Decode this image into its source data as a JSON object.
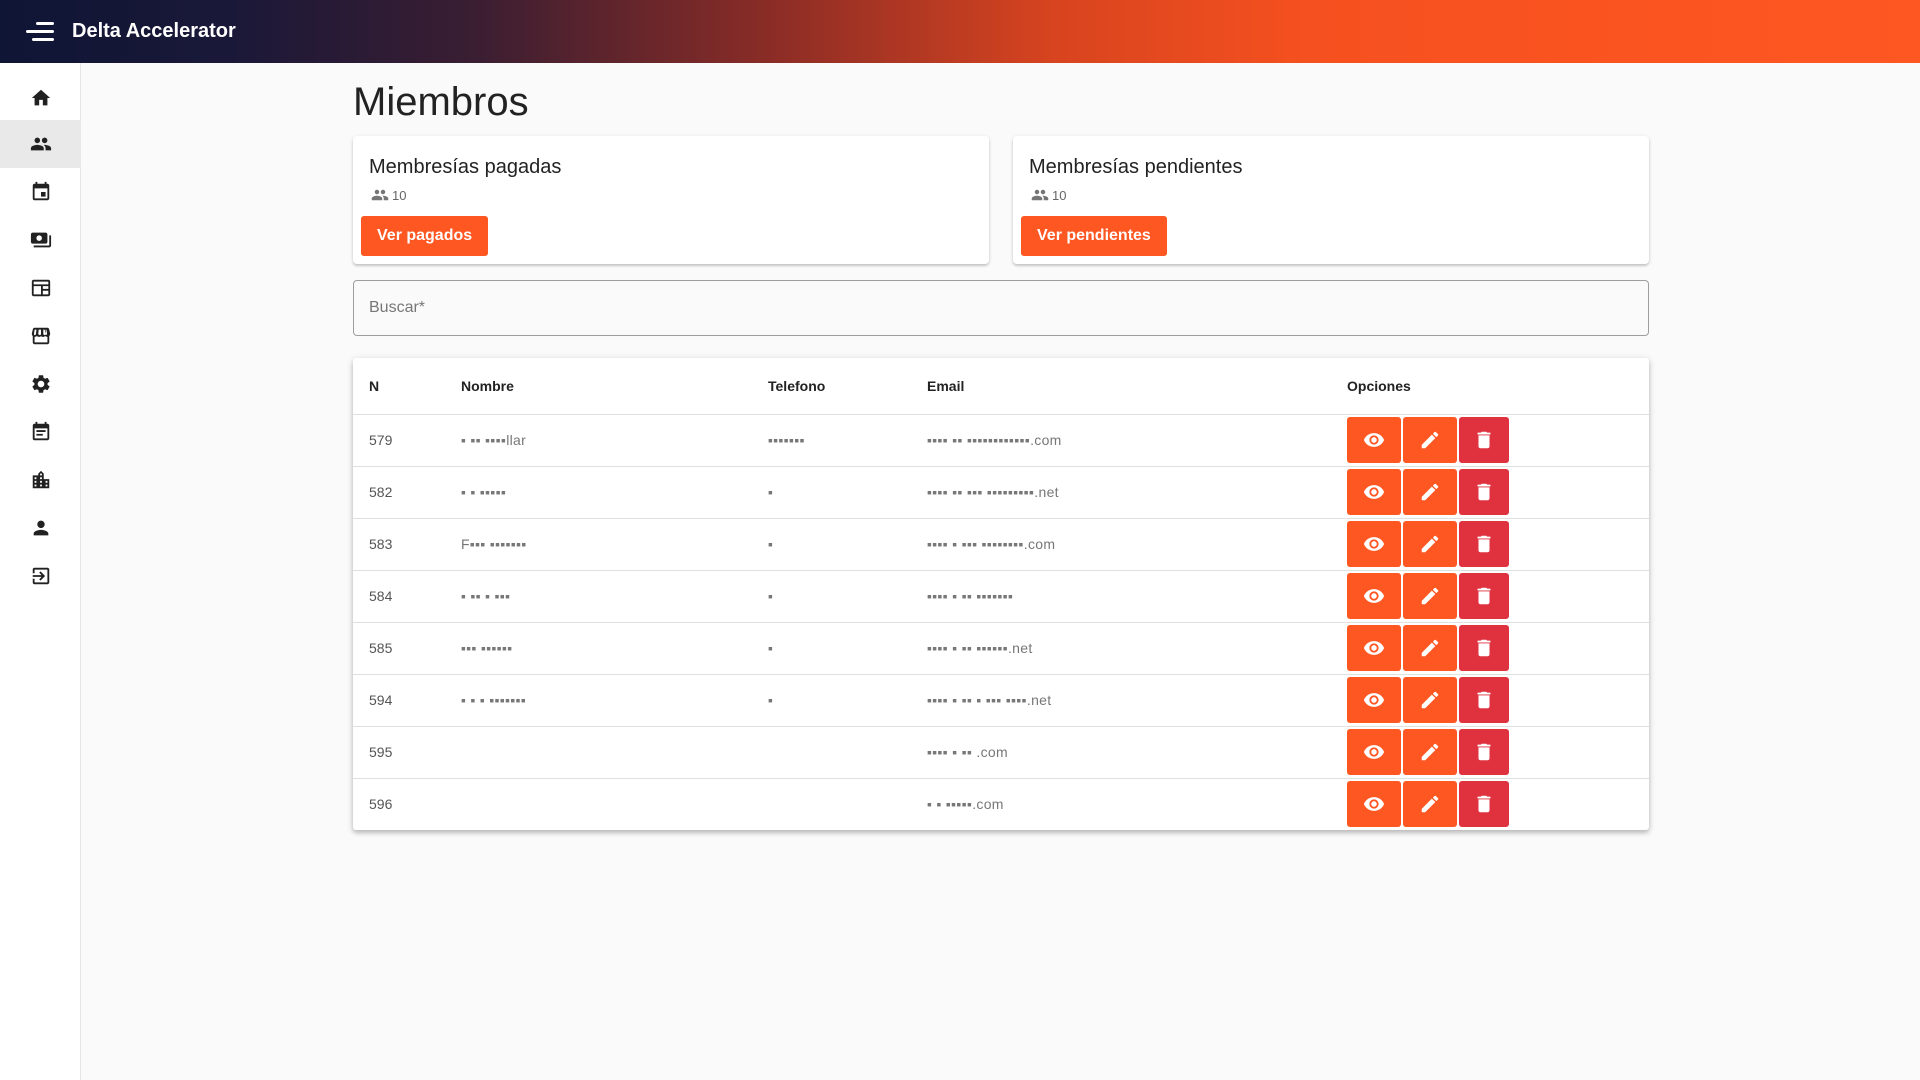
{
  "app": {
    "title": "Delta Accelerator"
  },
  "sidebar": {
    "items": [
      {
        "icon": "home-icon",
        "active": false
      },
      {
        "icon": "group-icon",
        "active": true
      },
      {
        "icon": "calendar-icon",
        "active": false
      },
      {
        "icon": "payments-icon",
        "active": false
      },
      {
        "icon": "table-icon",
        "active": false
      },
      {
        "icon": "store-icon",
        "active": false
      },
      {
        "icon": "gear-icon",
        "active": false
      },
      {
        "icon": "event-note-icon",
        "active": false
      },
      {
        "icon": "buildings-icon",
        "active": false
      },
      {
        "icon": "person-icon",
        "active": false
      },
      {
        "icon": "logout-icon",
        "active": false
      }
    ]
  },
  "page": {
    "title": "Miembros"
  },
  "cards": {
    "paid": {
      "title": "Membresías pagadas",
      "count": "10",
      "button": "Ver pagados"
    },
    "pending": {
      "title": "Membresías pendientes",
      "count": "10",
      "button": "Ver pendientes"
    }
  },
  "search": {
    "placeholder": "Buscar*",
    "value": ""
  },
  "table": {
    "headers": {
      "n": "N",
      "name": "Nombre",
      "phone": "Telefono",
      "email": "Email",
      "options": "Opciones"
    },
    "rows": [
      {
        "n": "579",
        "name": "▪ ▪▪ ▪▪▪▪llar",
        "phone": "▪▪▪▪▪▪▪",
        "email": "▪▪▪▪ ▪▪ ▪▪▪▪▪▪▪▪▪▪▪▪.com"
      },
      {
        "n": "582",
        "name": "▪ ▪ ▪▪▪▪▪",
        "phone": "▪",
        "email": "▪▪▪▪ ▪▪ ▪▪▪ ▪▪▪▪▪▪▪▪▪.net"
      },
      {
        "n": "583",
        "name": "F▪▪▪ ▪▪▪▪▪▪▪",
        "phone": "▪",
        "email": "▪▪▪▪ ▪ ▪▪▪ ▪▪▪▪▪▪▪▪.com"
      },
      {
        "n": "584",
        "name": "▪ ▪▪ ▪ ▪▪▪",
        "phone": "▪",
        "email": "▪▪▪▪ ▪ ▪▪ ▪▪▪▪▪▪▪"
      },
      {
        "n": "585",
        "name": "▪▪▪ ▪▪▪▪▪▪",
        "phone": "▪",
        "email": "▪▪▪▪ ▪ ▪▪ ▪▪▪▪▪▪.net"
      },
      {
        "n": "594",
        "name": "▪ ▪ ▪ ▪▪▪▪▪▪▪",
        "phone": "▪",
        "email": "▪▪▪▪ ▪ ▪▪ ▪ ▪▪▪ ▪▪▪▪.net"
      },
      {
        "n": "595",
        "name": "",
        "phone": "",
        "email": "▪▪▪▪ ▪ ▪▪ .com"
      },
      {
        "n": "596",
        "name": "",
        "phone": "",
        "email": "▪ ▪ ▪▪▪▪▪.com"
      }
    ]
  },
  "colors": {
    "accent": "#ff5722",
    "danger": "#e0313f",
    "header_dark": "#0f1535"
  }
}
